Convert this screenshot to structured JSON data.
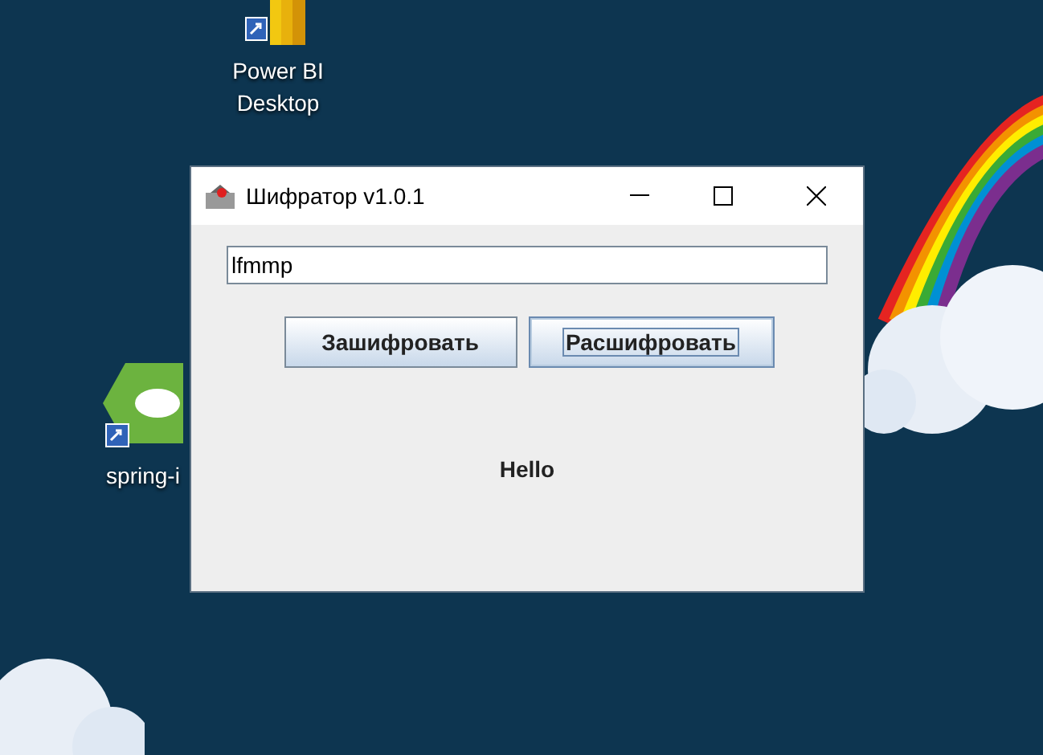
{
  "desktop_icons": [
    {
      "label_lines": [
        "Power BI",
        "Desktop"
      ],
      "kind": "powerbi"
    },
    {
      "label_lines": [
        "spring-i"
      ],
      "kind": "spring"
    }
  ],
  "window": {
    "title": "Шифратор v1.0.1",
    "text_field": {
      "value": "lfmmp"
    },
    "buttons": [
      {
        "label": "Зашифровать",
        "focused": false
      },
      {
        "label": "Расшифровать",
        "focused": true
      }
    ],
    "output_label": "Hello"
  }
}
